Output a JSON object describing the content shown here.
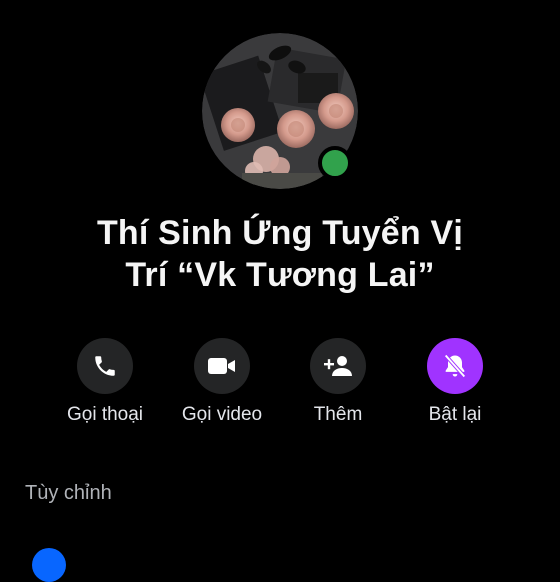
{
  "profile": {
    "name_line1": "Thí Sinh Ứng Tuyển Vị",
    "name_line2": "Trí “Vk Tương Lai”",
    "status": "online",
    "status_color": "#31a24c"
  },
  "actions": [
    {
      "label": "Gọi thoại",
      "icon": "phone-icon"
    },
    {
      "label": "Gọi video",
      "icon": "video-camera-icon"
    },
    {
      "label": "Thêm",
      "icon": "add-person-icon"
    },
    {
      "label": "Bật lại",
      "icon": "bell-muted-icon",
      "accent": "#a033ff"
    }
  ],
  "sections": {
    "customize_title": "Tùy chỉnh"
  },
  "colors": {
    "background": "#000000",
    "button_bg": "#242526",
    "accent_purple": "#a033ff",
    "accent_blue": "#0866ff"
  }
}
